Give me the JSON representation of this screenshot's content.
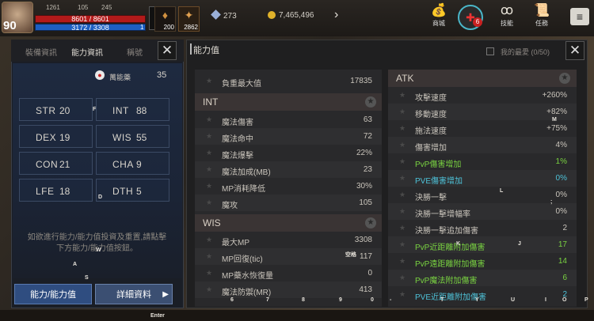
{
  "player": {
    "level": "90",
    "hp": "8601 / 8601",
    "mp": "3172 / 3308",
    "mp_small": "1",
    "top_small": [
      "1261",
      "105",
      "245"
    ],
    "potion_count_1": "200",
    "potion_count_2": "2862"
  },
  "currency": {
    "diamond": "273",
    "gold": "7,465,496"
  },
  "topmenu": [
    {
      "label": "商城",
      "icon": "shop-icon"
    },
    {
      "label": "",
      "icon": "grade-icon",
      "badge": "6"
    },
    {
      "label": "技能",
      "icon": "skill-icon"
    },
    {
      "label": "任務",
      "icon": "quest-icon"
    }
  ],
  "left": {
    "tabs": [
      "裝備資訊",
      "能力資訊",
      "稱號"
    ],
    "points_label": "萬能藥",
    "points": "35",
    "stats": [
      {
        "name": "STR",
        "value": "20"
      },
      {
        "name": "INT",
        "value": "88"
      },
      {
        "name": "DEX",
        "value": "19"
      },
      {
        "name": "WIS",
        "value": "55"
      },
      {
        "name": "CON",
        "value": "21"
      },
      {
        "name": "CHA",
        "value": "9"
      },
      {
        "name": "LFE",
        "value": "18"
      },
      {
        "name": "DTH",
        "value": "5"
      }
    ],
    "hint": "如欲進行能力/能力值投資及重置,請點擊下方能力/能力值按鈕。",
    "btn_a": "能力/能力值",
    "btn_b": "詳細資料"
  },
  "right": {
    "title": "能力值",
    "fav": "我的最愛 (0/50)",
    "weight": {
      "label": "負重最大值",
      "value": "17835"
    },
    "int": {
      "title": "INT",
      "rows": [
        {
          "label": "魔法傷害",
          "value": "63"
        },
        {
          "label": "魔法命中",
          "value": "72"
        },
        {
          "label": "魔法爆擊",
          "value": "22%"
        },
        {
          "label": "魔法加成(MB)",
          "value": "23"
        },
        {
          "label": "MP消耗降低",
          "value": "30%"
        },
        {
          "label": "魔攻",
          "value": "105"
        }
      ]
    },
    "wis": {
      "title": "WIS",
      "rows": [
        {
          "label": "最大MP",
          "value": "3308"
        },
        {
          "label": "MP回復(tic)",
          "value": "117"
        },
        {
          "label": "MP藥水恢復量",
          "value": "0"
        },
        {
          "label": "魔法防禦(MR)",
          "value": "413"
        }
      ]
    },
    "atk": {
      "title": "ATK",
      "rows": [
        {
          "label": "攻擊速度",
          "value": "+260%",
          "color": "#c9c4bb"
        },
        {
          "label": "移動速度",
          "value": "+82%",
          "color": "#c9c4bb"
        },
        {
          "label": "施法速度",
          "value": "+75%",
          "color": "#c9c4bb"
        },
        {
          "label": "傷害增加",
          "value": "4%",
          "color": "#c9c4bb"
        },
        {
          "label": "PvP傷害增加",
          "value": "1%",
          "color": "grn"
        },
        {
          "label": "PVE傷害增加",
          "value": "0%",
          "color": "cyn"
        },
        {
          "label": "決勝一擊",
          "value": "0%",
          "color": "#c9c4bb"
        },
        {
          "label": "決勝一擊增幅率",
          "value": "0%",
          "color": "#c9c4bb"
        },
        {
          "label": "決勝一擊追加傷害",
          "value": "2",
          "color": "#c9c4bb"
        },
        {
          "label": "PvP近距離附加傷害",
          "value": "17",
          "color": "grn"
        },
        {
          "label": "PvP遠距離附加傷害",
          "value": "14",
          "color": "grn"
        },
        {
          "label": "PvP魔法附加傷害",
          "value": "6",
          "color": "grn"
        },
        {
          "label": "PVE近距離附加傷害",
          "value": "2",
          "color": "cyn"
        }
      ]
    }
  },
  "keys": {
    "row": [
      "6",
      "7",
      "8",
      "9",
      "0",
      "-",
      "T",
      "Y",
      "U",
      "I",
      "O",
      "P"
    ],
    "enter": "Enter",
    "space": "空格",
    "misc": [
      "F",
      "D",
      "W",
      "A",
      "S",
      "K",
      "J",
      "L",
      "M",
      ";"
    ]
  }
}
